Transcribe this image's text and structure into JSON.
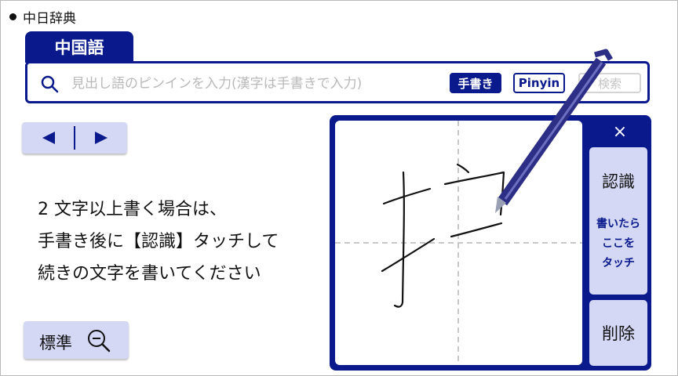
{
  "app": {
    "title": "中日辞典"
  },
  "tab": {
    "label": "中国語"
  },
  "search": {
    "placeholder": "見出し語のピンインを入力(漢字は手書きで入力)",
    "value": "",
    "handwriting_label": "手書き",
    "pinyin_label": "Pinyin",
    "search_label": "検索"
  },
  "instructions": {
    "line1": "2 文字以上書く場合は、",
    "line2": "手書き後に【認識】タッチして",
    "line3": "続きの文字を書いてください"
  },
  "zoom": {
    "label": "標準"
  },
  "handwriting_panel": {
    "close_symbol": "×",
    "recognize_label": "認識",
    "recognize_hint_1": "書いたら",
    "recognize_hint_2": "ここを",
    "recognize_hint_3": "タッチ",
    "delete_label": "削除"
  },
  "colors": {
    "brand_navy": "#0a1a8c",
    "button_lavender": "#d4d8f5",
    "placeholder_gray": "#b9b9b9"
  }
}
